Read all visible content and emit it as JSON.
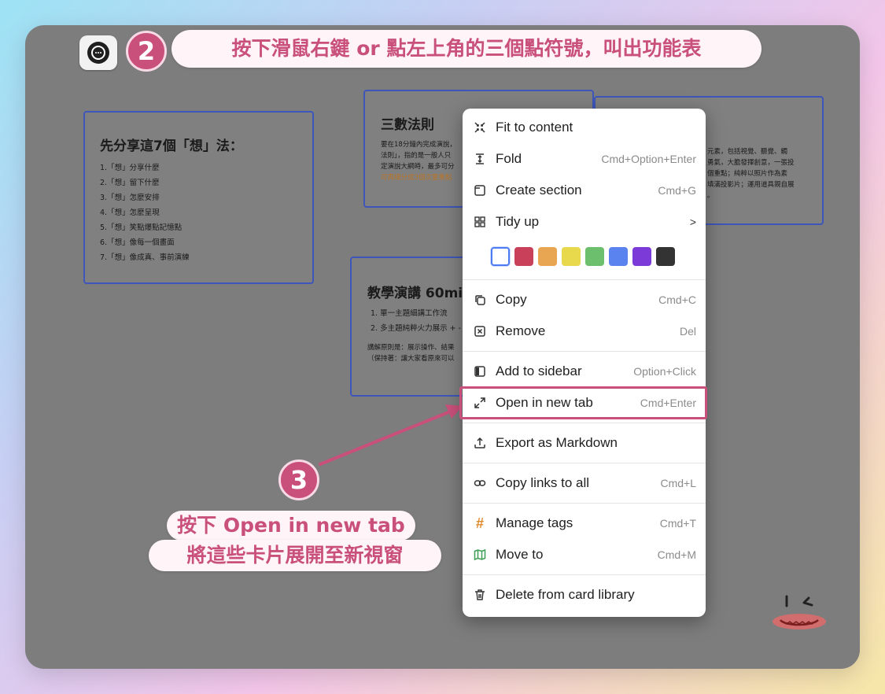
{
  "step2": {
    "badge": "2",
    "text": "按下滑鼠右鍵 or 點左上角的三個點符號，叫出功能表"
  },
  "step3": {
    "badge": "3",
    "line1": "按下 Open in new tab",
    "line2": "將這些卡片展開至新視窗"
  },
  "cards": {
    "think": {
      "title": "先分享這7個「想」法：",
      "items": [
        "1.「想」分享什麼",
        "2.「想」留下什麼",
        "3.「想」怎麼安排",
        "4.「想」怎麼呈現",
        "5.「想」笑點爆點記憶點",
        "6.「想」像每一個畫面",
        "7.「想」像成真、事前演練"
      ]
    },
    "rule": {
      "title": "三數法則",
      "lines": [
        "要在18分鐘內完成演說，",
        "法則」，指的是一般人只",
        "定演說大綱時，最多可分",
        "可再細分成3個次要重點"
      ]
    },
    "right": {
      "lines": [
        "元素，包括視覺、聽覺、觸",
        "勇氣，大膽發揮創意，一張投",
        "個重點；純粹以照片作為素",
        "填滿投影片；運用道具親自展",
        "。"
      ]
    },
    "teach": {
      "title": "教學演講 60mi",
      "items": [
        "1.   單一主題細講工作流",
        "2.   多主題純粹火力展示 + -"
      ],
      "notes": [
        "講解原則是：展示操作、結果",
        "（保持著：讓大家看原來可以"
      ]
    }
  },
  "menu": {
    "items": [
      {
        "icon": "fit-icon",
        "label": "Fit to content",
        "shortcut": ""
      },
      {
        "icon": "fold-icon",
        "label": "Fold",
        "shortcut": "Cmd+Option+Enter"
      },
      {
        "icon": "section-icon",
        "label": "Create section",
        "shortcut": "Cmd+G"
      },
      {
        "icon": "grid-icon",
        "label": "Tidy up",
        "shortcut": ">"
      },
      {
        "icon": "copy-icon",
        "label": "Copy",
        "shortcut": "Cmd+C"
      },
      {
        "icon": "remove-icon",
        "label": "Remove",
        "shortcut": "Del"
      },
      {
        "icon": "sidebar-icon",
        "label": "Add to sidebar",
        "shortcut": "Option+Click"
      },
      {
        "icon": "expand-icon",
        "label": "Open in new tab",
        "shortcut": "Cmd+Enter"
      },
      {
        "icon": "upload-icon",
        "label": "Export as Markdown",
        "shortcut": ""
      },
      {
        "icon": "link-icon",
        "label": "Copy links to all",
        "shortcut": "Cmd+L"
      },
      {
        "icon": "hash-icon",
        "label": "Manage tags",
        "shortcut": "Cmd+T"
      },
      {
        "icon": "map-icon",
        "label": "Move to",
        "shortcut": "Cmd+M"
      },
      {
        "icon": "trash-icon",
        "label": "Delete from card library",
        "shortcut": ""
      }
    ],
    "colors": [
      "#ffffff",
      "#c8405a",
      "#e8a552",
      "#e7d84c",
      "#6cbf6c",
      "#5b83f0",
      "#7c3ad8",
      "#333333"
    ]
  },
  "colors": {
    "accent": "#c9507a",
    "card_border": "#3e56b9"
  }
}
